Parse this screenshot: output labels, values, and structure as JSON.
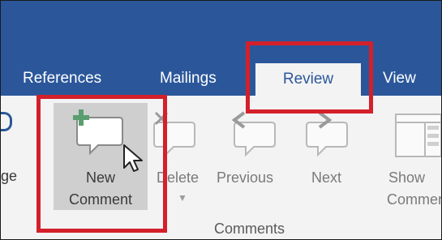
{
  "tabs": {
    "references": "References",
    "mailings": "Mailings",
    "review": "Review",
    "view": "View"
  },
  "ribbon": {
    "left_partial": "ge",
    "new_comment": [
      "New",
      "Comment"
    ],
    "delete": "Delete",
    "previous": "Previous",
    "next": "Next",
    "show_comments": [
      "Show",
      "Comments"
    ],
    "group_label": "Comments"
  },
  "colors": {
    "title_bar": "#2b579a",
    "ribbon_bg": "#f3f3f3",
    "highlight_box": "#d3202a",
    "add_plus": "#5a9e6f"
  },
  "icons": {
    "new_comment": "speech-bubble-plus-icon",
    "delete": "speech-bubble-x-icon",
    "previous": "speech-bubble-arrow-left-icon",
    "next": "speech-bubble-arrow-right-icon",
    "show_comments": "comments-pane-icon",
    "cursor": "mouse-pointer-icon"
  }
}
